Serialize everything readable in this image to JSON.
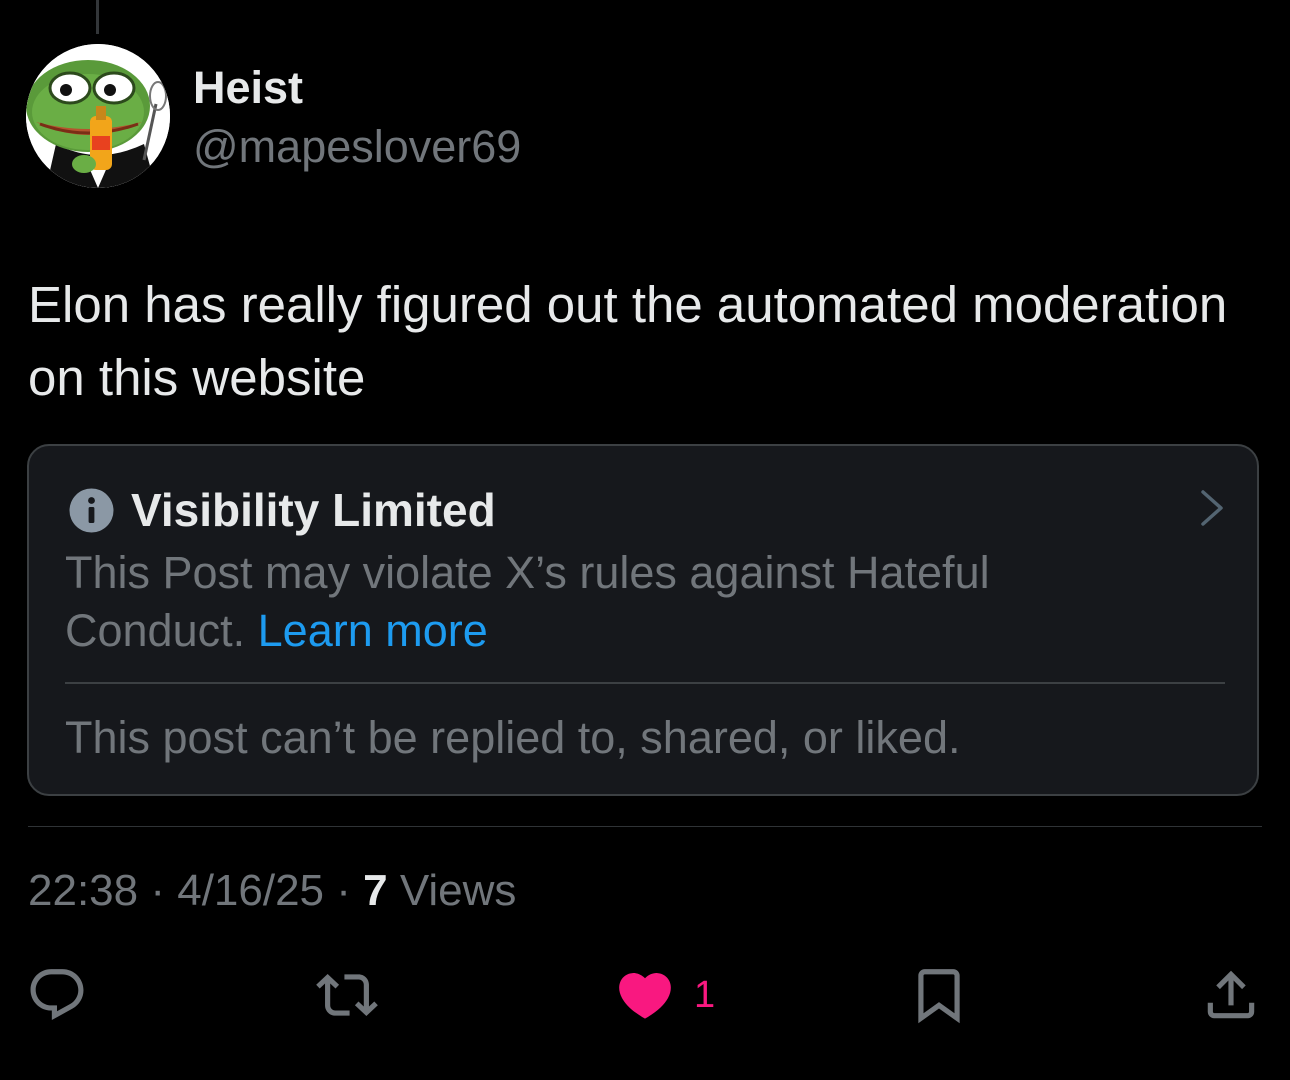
{
  "author": {
    "display_name": "Heist",
    "handle": "@mapeslover69"
  },
  "post": {
    "text": "Elon has really figured out the automated moderation on this website"
  },
  "notice": {
    "title": "Visibility Limited",
    "body": "This Post may violate X’s rules against Hateful Conduct.",
    "learn_more": "Learn more",
    "footer": "This post can’t be replied to, shared, or liked.",
    "icon": "info-icon"
  },
  "meta": {
    "time": "22:38",
    "separator": " · ",
    "date": "4/16/25",
    "views_count": "7",
    "views_label": " Views"
  },
  "actions": {
    "like_count": "1",
    "icons": [
      "reply-icon",
      "repost-icon",
      "like-icon",
      "bookmark-icon",
      "share-icon"
    ]
  },
  "colors": {
    "background": "#000000",
    "text_primary": "#e7e9ea",
    "text_secondary": "#71767b",
    "link": "#1d9bf0",
    "like": "#f91880",
    "card_background": "#16181c",
    "card_border": "#3c4043"
  }
}
